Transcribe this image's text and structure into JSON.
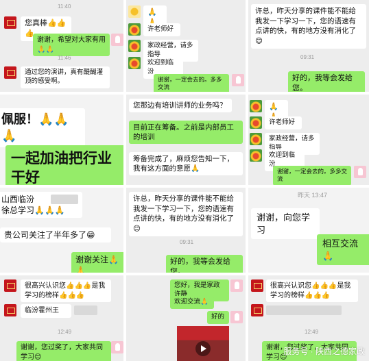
{
  "p1": {
    "time_a": "11:40",
    "msg1": "您真棒👍👍👍",
    "msg2": "谢谢，希望对大家有用🙏🙏",
    "time_b": "11:46",
    "msg3": "通过您的演讲，真有醍醐灌顶的感受啊。"
  },
  "p2": {
    "msg1": "🙏🙏",
    "msg2": "许老师好",
    "msg3": "家政经营，请多指导",
    "msg4": "欢迎到临汾",
    "msg5": "谢谢，一定会去的。多多交流"
  },
  "p3": {
    "msg1": "许总，昨天分享的课件能不能给我发一下学习一下，您的语速有点讲的快，有的地方没有消化了😊",
    "time": "09:31",
    "msg2": "好的，我等会发给您。"
  },
  "p4": {
    "msg1": "佩服！🙏🙏🙏",
    "msg2": "一起加油把行业干好"
  },
  "p5": {
    "msg1": "您那边有培训讲师的业务吗？",
    "msg2": "目前正在筹备。之前是内部员工的培训",
    "msg3": "筹备完成了，麻烦您告知一下，我有这方面的意愿🙏"
  },
  "p6": {
    "msg1": "🙏🙏",
    "msg2": "许老师好",
    "msg3": "家政经营，请多指导",
    "msg4": "欢迎到临汾",
    "msg5": "谢谢，一定会去的。多多交流"
  },
  "p7": {
    "msg1": "山西临汾",
    "msg1b": "徐总学习🙏🙏🙏",
    "msg2": "贵公司关注了半年多了😁",
    "msg3": "谢谢关注🙏🙏"
  },
  "p8": {
    "msg1": "许总，昨天分享的课件能不能给我发一下学习一下，您的语速有点讲的快，有的地方没有消化了😊",
    "time": "09:31",
    "msg2": "好的，我等会发给您。"
  },
  "p9": {
    "time": "昨天 13:47",
    "msg1": "谢谢，向您学习",
    "msg2": "相互交流🙏"
  },
  "p10": {
    "msg1": "很高兴认识您👍👍👍是我学习的榜样👍👍👍",
    "msg2": "临汾霍州王",
    "time": "12:49",
    "msg3": "谢谢，您过奖了，大家共同学习😊"
  },
  "p11": {
    "msg1": "您好，我是",
    "msg1b": "家政许静",
    "msg2": "欢迎交流🙏",
    "msg3": "好的"
  },
  "p12": {
    "msg1": "很高兴认识您👍👍👍是我学习的榜样👍👍👍",
    "time": "12:49",
    "msg2": "谢谢，您过奖了，大家共同学习😊"
  },
  "watermark": "服务号 · 陕西之德家政"
}
